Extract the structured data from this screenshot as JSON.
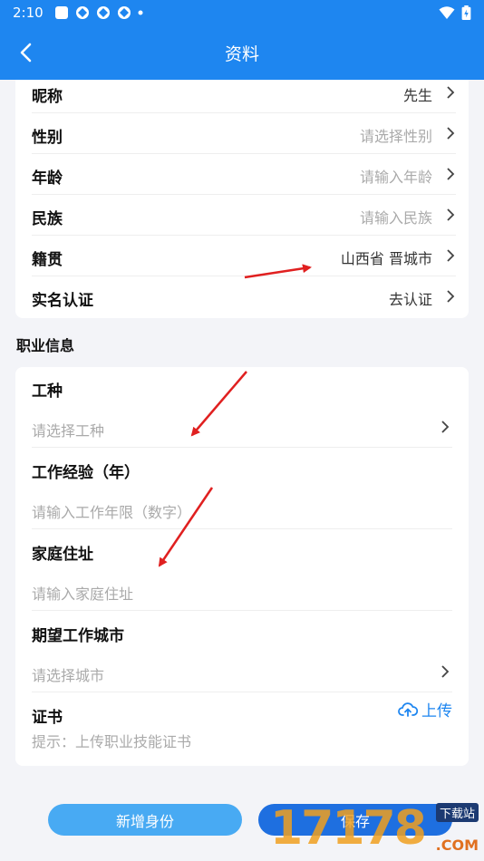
{
  "statusbar": {
    "time": "2:10"
  },
  "header": {
    "title": "资料"
  },
  "profile": {
    "rows": [
      {
        "label": "昵称",
        "value": "先生"
      },
      {
        "label": "性别",
        "value": "请选择性别"
      },
      {
        "label": "年龄",
        "value": "请输入年龄"
      },
      {
        "label": "民族",
        "value": "请输入民族"
      },
      {
        "label": "籍贯",
        "value": "山西省 晋城市"
      },
      {
        "label": "实名认证",
        "value": "去认证"
      }
    ]
  },
  "career": {
    "section_title": "职业信息",
    "fields": [
      {
        "label": "工种",
        "placeholder": "请选择工种"
      },
      {
        "label": "工作经验（年）",
        "placeholder": "请输入工作年限（数字）"
      },
      {
        "label": "家庭住址",
        "placeholder": "请输入家庭住址"
      },
      {
        "label": "期望工作城市",
        "placeholder": "请选择城市"
      },
      {
        "label": "证书",
        "placeholder": "提示：上传职业技能证书"
      }
    ],
    "upload_label": "上传"
  },
  "actions": {
    "add_identity": "新增身份",
    "save": "保存"
  },
  "watermark": {
    "digits": "17178",
    "download": "下载站",
    "domain": ".COM"
  },
  "colors": {
    "primary": "#1e86f0",
    "annotation": "#e02020"
  }
}
